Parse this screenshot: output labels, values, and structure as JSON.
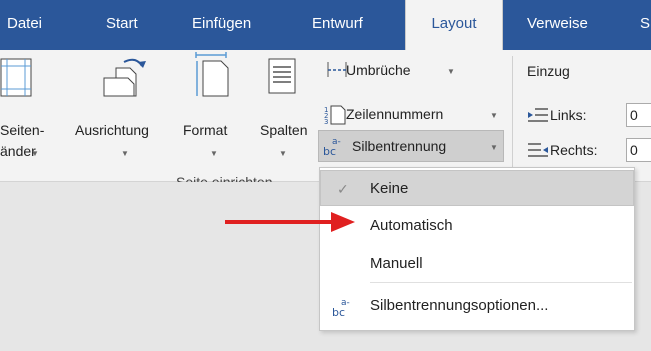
{
  "tabs": {
    "datei": "Datei",
    "start": "Start",
    "einfuegen": "Einfügen",
    "entwurf": "Entwurf",
    "layout": "Layout",
    "verweise": "Verweise",
    "cut": "S"
  },
  "ribbon": {
    "seitenraender_line1": "Seiten-",
    "seitenraender_line2": "änder",
    "ausrichtung": "Ausrichtung",
    "format": "Format",
    "spalten": "Spalten",
    "umbrueche": "Umbrüche",
    "zeilennummern": "Zeilennummern",
    "silbentrennung": "Silbentrennung",
    "group_label": "Seite einrichten",
    "einzug": "Einzug",
    "links": "Links:",
    "rechts": "Rechts:",
    "links_value": "0",
    "rechts_value": "0",
    "hyphen_icon_top": "a-",
    "hyphen_icon_bottom": "bc"
  },
  "menu": {
    "keine": "Keine",
    "automatisch": "Automatisch",
    "manuell": "Manuell",
    "optionen": "Silbentrennungsoptionen...",
    "options_icon_top": "a-",
    "options_icon_bottom": "bc",
    "checked_item": "Keine"
  },
  "colors": {
    "tab_bar": "#2b579a",
    "ribbon_bg": "#f3f3f3",
    "arrow": "#e02020"
  }
}
